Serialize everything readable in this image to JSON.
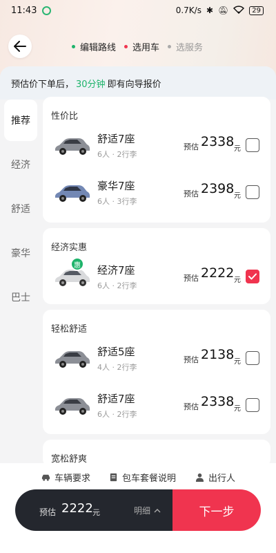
{
  "status_bar": {
    "time": "11:43",
    "network_speed": "0.7K/s",
    "battery": "29"
  },
  "nav": {
    "steps": [
      "编辑路线",
      "选用车",
      "选服务"
    ]
  },
  "notice": {
    "prefix": "预估价下单后，",
    "highlight": "30分钟",
    "suffix": "即有向导报价"
  },
  "sidebar": {
    "items": [
      "推荐",
      "经济",
      "舒适",
      "豪华",
      "巴士"
    ],
    "active": 0
  },
  "sections": [
    {
      "title": "性价比",
      "cars": [
        {
          "name": "舒适7座",
          "sub": "6人 · 2行李",
          "est": "预估",
          "price": "2338",
          "unit": "元",
          "checked": false,
          "color": "#8c8f96"
        },
        {
          "name": "豪华7座",
          "sub": "6人 · 3行李",
          "est": "预估",
          "price": "2398",
          "unit": "元",
          "checked": false,
          "color": "#7388b4"
        }
      ]
    },
    {
      "title": "经济实惠",
      "cars": [
        {
          "name": "经济7座",
          "sub": "6人 · 2行李",
          "est": "预估",
          "price": "2222",
          "unit": "元",
          "checked": true,
          "badge": "惠",
          "color": "#d9dadc"
        }
      ]
    },
    {
      "title": "轻松舒适",
      "cars": [
        {
          "name": "舒适5座",
          "sub": "4人 · 2行李",
          "est": "预估",
          "price": "2138",
          "unit": "元",
          "checked": false,
          "color": "#8c8f96"
        },
        {
          "name": "舒适7座",
          "sub": "6人 · 2行李",
          "est": "预估",
          "price": "2338",
          "unit": "元",
          "checked": false,
          "color": "#8c8f96"
        }
      ]
    },
    {
      "title": "宽松舒爽",
      "cars": []
    }
  ],
  "footer": {
    "links": [
      "车辆要求",
      "包车套餐说明",
      "出行人"
    ],
    "est_label": "预估",
    "price": "2222",
    "unit": "元",
    "detail": "明细",
    "next": "下一步"
  },
  "colors": {
    "accent_red": "#f0344f",
    "accent_green": "#1db36a",
    "dark_bar": "#24272e"
  }
}
